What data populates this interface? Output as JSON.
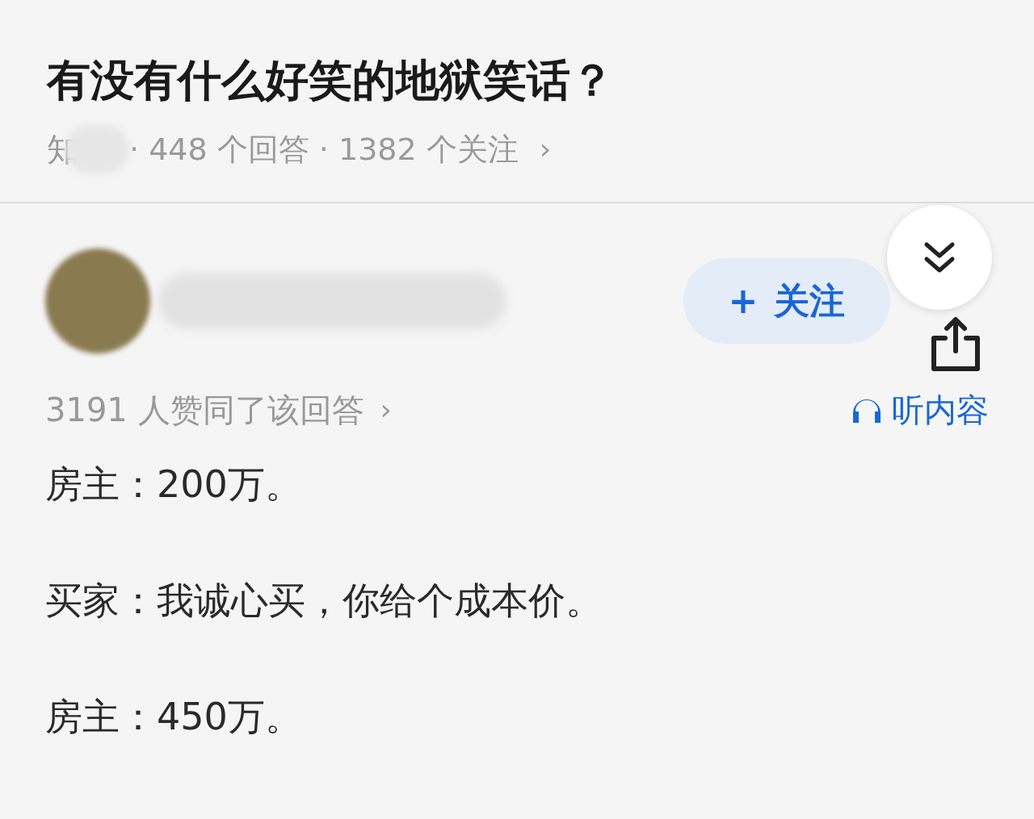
{
  "question": {
    "title": "有没有什么好笑的地狱笑话？",
    "source": "知",
    "stats": "· 448 个回答 · 1382 个关注",
    "chevron": "›"
  },
  "follow_button": {
    "label": "关注",
    "plus": "+"
  },
  "votes": {
    "text": "3191 人赞同了该回答",
    "chevron": "›"
  },
  "listen": {
    "label": "听内容"
  },
  "answer": {
    "paragraphs": [
      "房主：200万。",
      "买家：我诚心买，你给个成本价。",
      "房主：450万。"
    ]
  }
}
